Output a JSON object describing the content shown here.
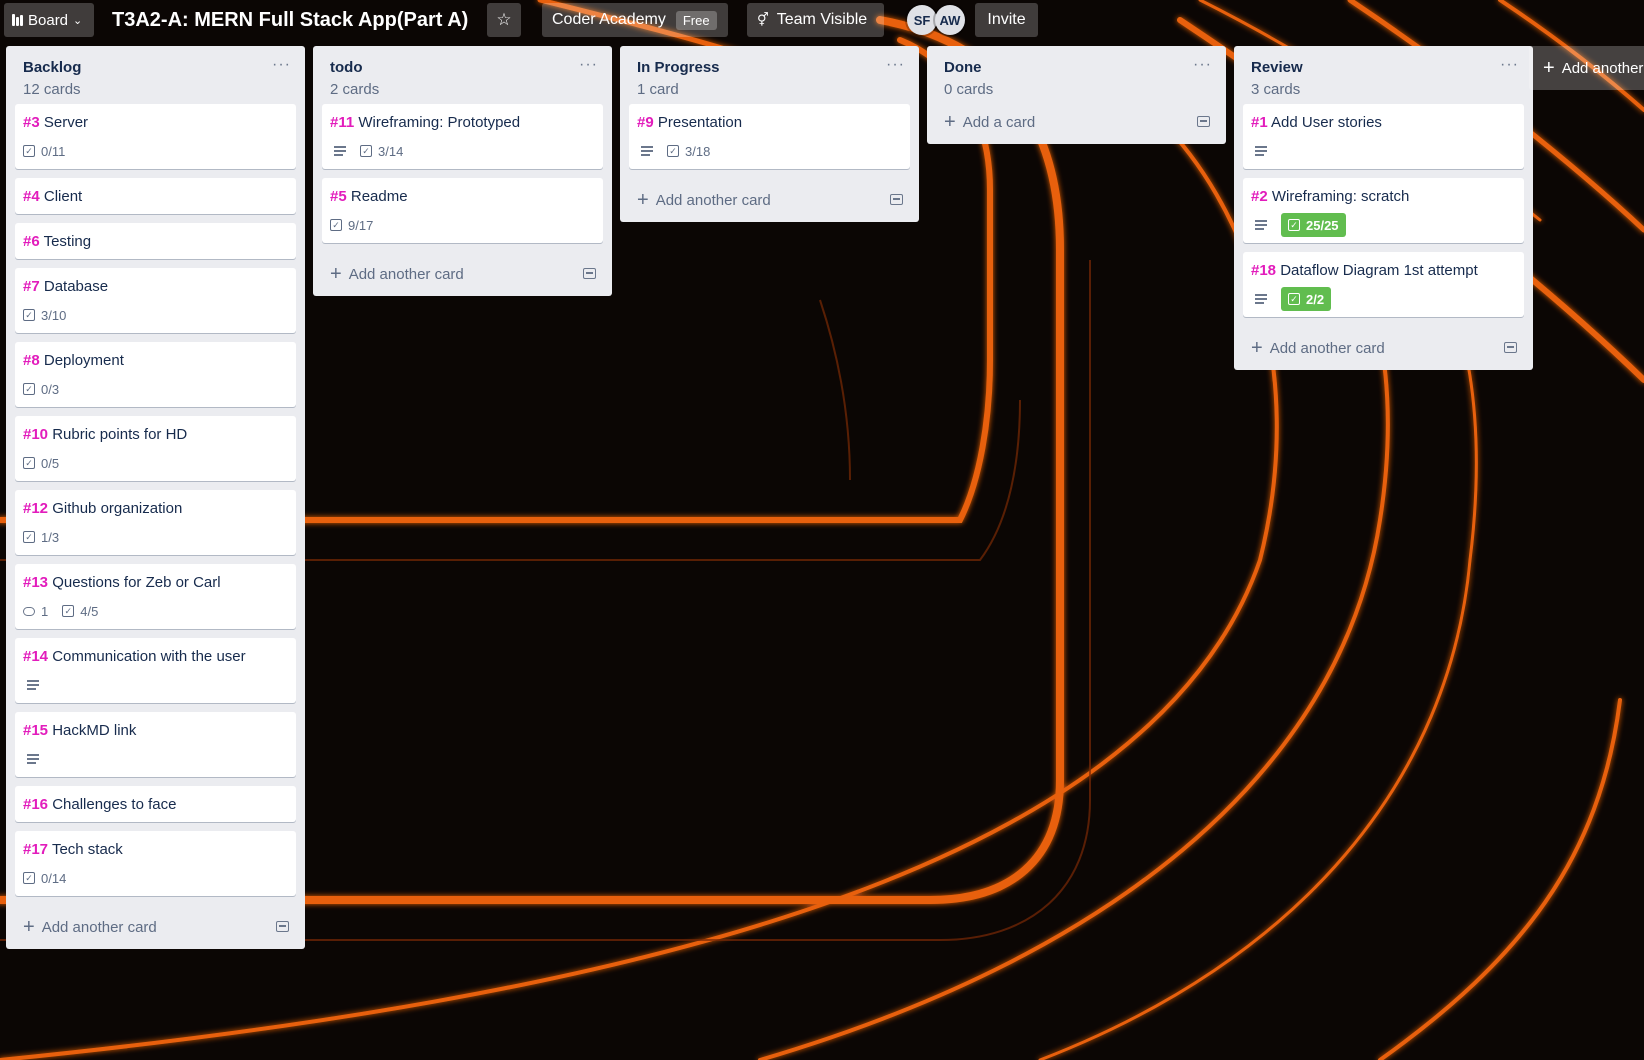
{
  "header": {
    "board_label": "Board",
    "title": "T3A2-A: MERN Full Stack App(Part A)",
    "team": "Coder Academy",
    "team_badge": "Free",
    "visibility": "Team Visible",
    "members": [
      "SF",
      "AW"
    ],
    "invite": "Invite"
  },
  "lists": [
    {
      "title": "Backlog",
      "count": "12 cards",
      "cards": [
        {
          "num": "#3",
          "title": "Server",
          "checklist": "0/11"
        },
        {
          "num": "#4",
          "title": "Client"
        },
        {
          "num": "#6",
          "title": "Testing"
        },
        {
          "num": "#7",
          "title": "Database",
          "checklist": "3/10"
        },
        {
          "num": "#8",
          "title": "Deployment",
          "checklist": "0/3"
        },
        {
          "num": "#10",
          "title": "Rubric points for HD",
          "checklist": "0/5"
        },
        {
          "num": "#12",
          "title": "Github organization",
          "checklist": "1/3"
        },
        {
          "num": "#13",
          "title": "Questions for Zeb or Carl",
          "comments": "1",
          "checklist": "4/5"
        },
        {
          "num": "#14",
          "title": "Communication with the user",
          "description": true
        },
        {
          "num": "#15",
          "title": "HackMD link",
          "description": true
        },
        {
          "num": "#16",
          "title": "Challenges to face"
        },
        {
          "num": "#17",
          "title": "Tech stack",
          "checklist": "0/14"
        }
      ],
      "add_label": "Add another card"
    },
    {
      "title": "todo",
      "count": "2 cards",
      "cards": [
        {
          "num": "#11",
          "title": "Wireframing: Prototyped",
          "description": true,
          "checklist": "3/14"
        },
        {
          "num": "#5",
          "title": "Readme",
          "checklist": "9/17"
        }
      ],
      "add_label": "Add another card"
    },
    {
      "title": "In Progress",
      "count": "1 card",
      "cards": [
        {
          "num": "#9",
          "title": "Presentation",
          "description": true,
          "checklist": "3/18"
        }
      ],
      "add_label": "Add another card"
    },
    {
      "title": "Done",
      "count": "0 cards",
      "cards": [],
      "add_label": "Add a card"
    },
    {
      "title": "Review",
      "count": "3 cards",
      "cards": [
        {
          "num": "#1",
          "title": "Add User stories",
          "description": true
        },
        {
          "num": "#2",
          "title": "Wireframing: scratch",
          "description": true,
          "checklist": "25/25",
          "complete": true
        },
        {
          "num": "#18",
          "title": "Dataflow Diagram 1st attempt",
          "description": true,
          "checklist": "2/2",
          "complete": true
        }
      ],
      "add_label": "Add another card"
    }
  ],
  "add_list_label": "Add another list",
  "colors": {
    "card_number": "#e21cbc",
    "checklist_complete": "#61bd4f",
    "list_bg": "#ebecf0",
    "background": "#0b0604",
    "accent_stripes": "#e8610d"
  },
  "icons": [
    "board-icon",
    "chevron-down-icon",
    "star-icon",
    "team-visible-icon",
    "list-menu-icon",
    "plus-icon",
    "card-template-icon",
    "description-icon",
    "checklist-icon",
    "comment-icon"
  ]
}
